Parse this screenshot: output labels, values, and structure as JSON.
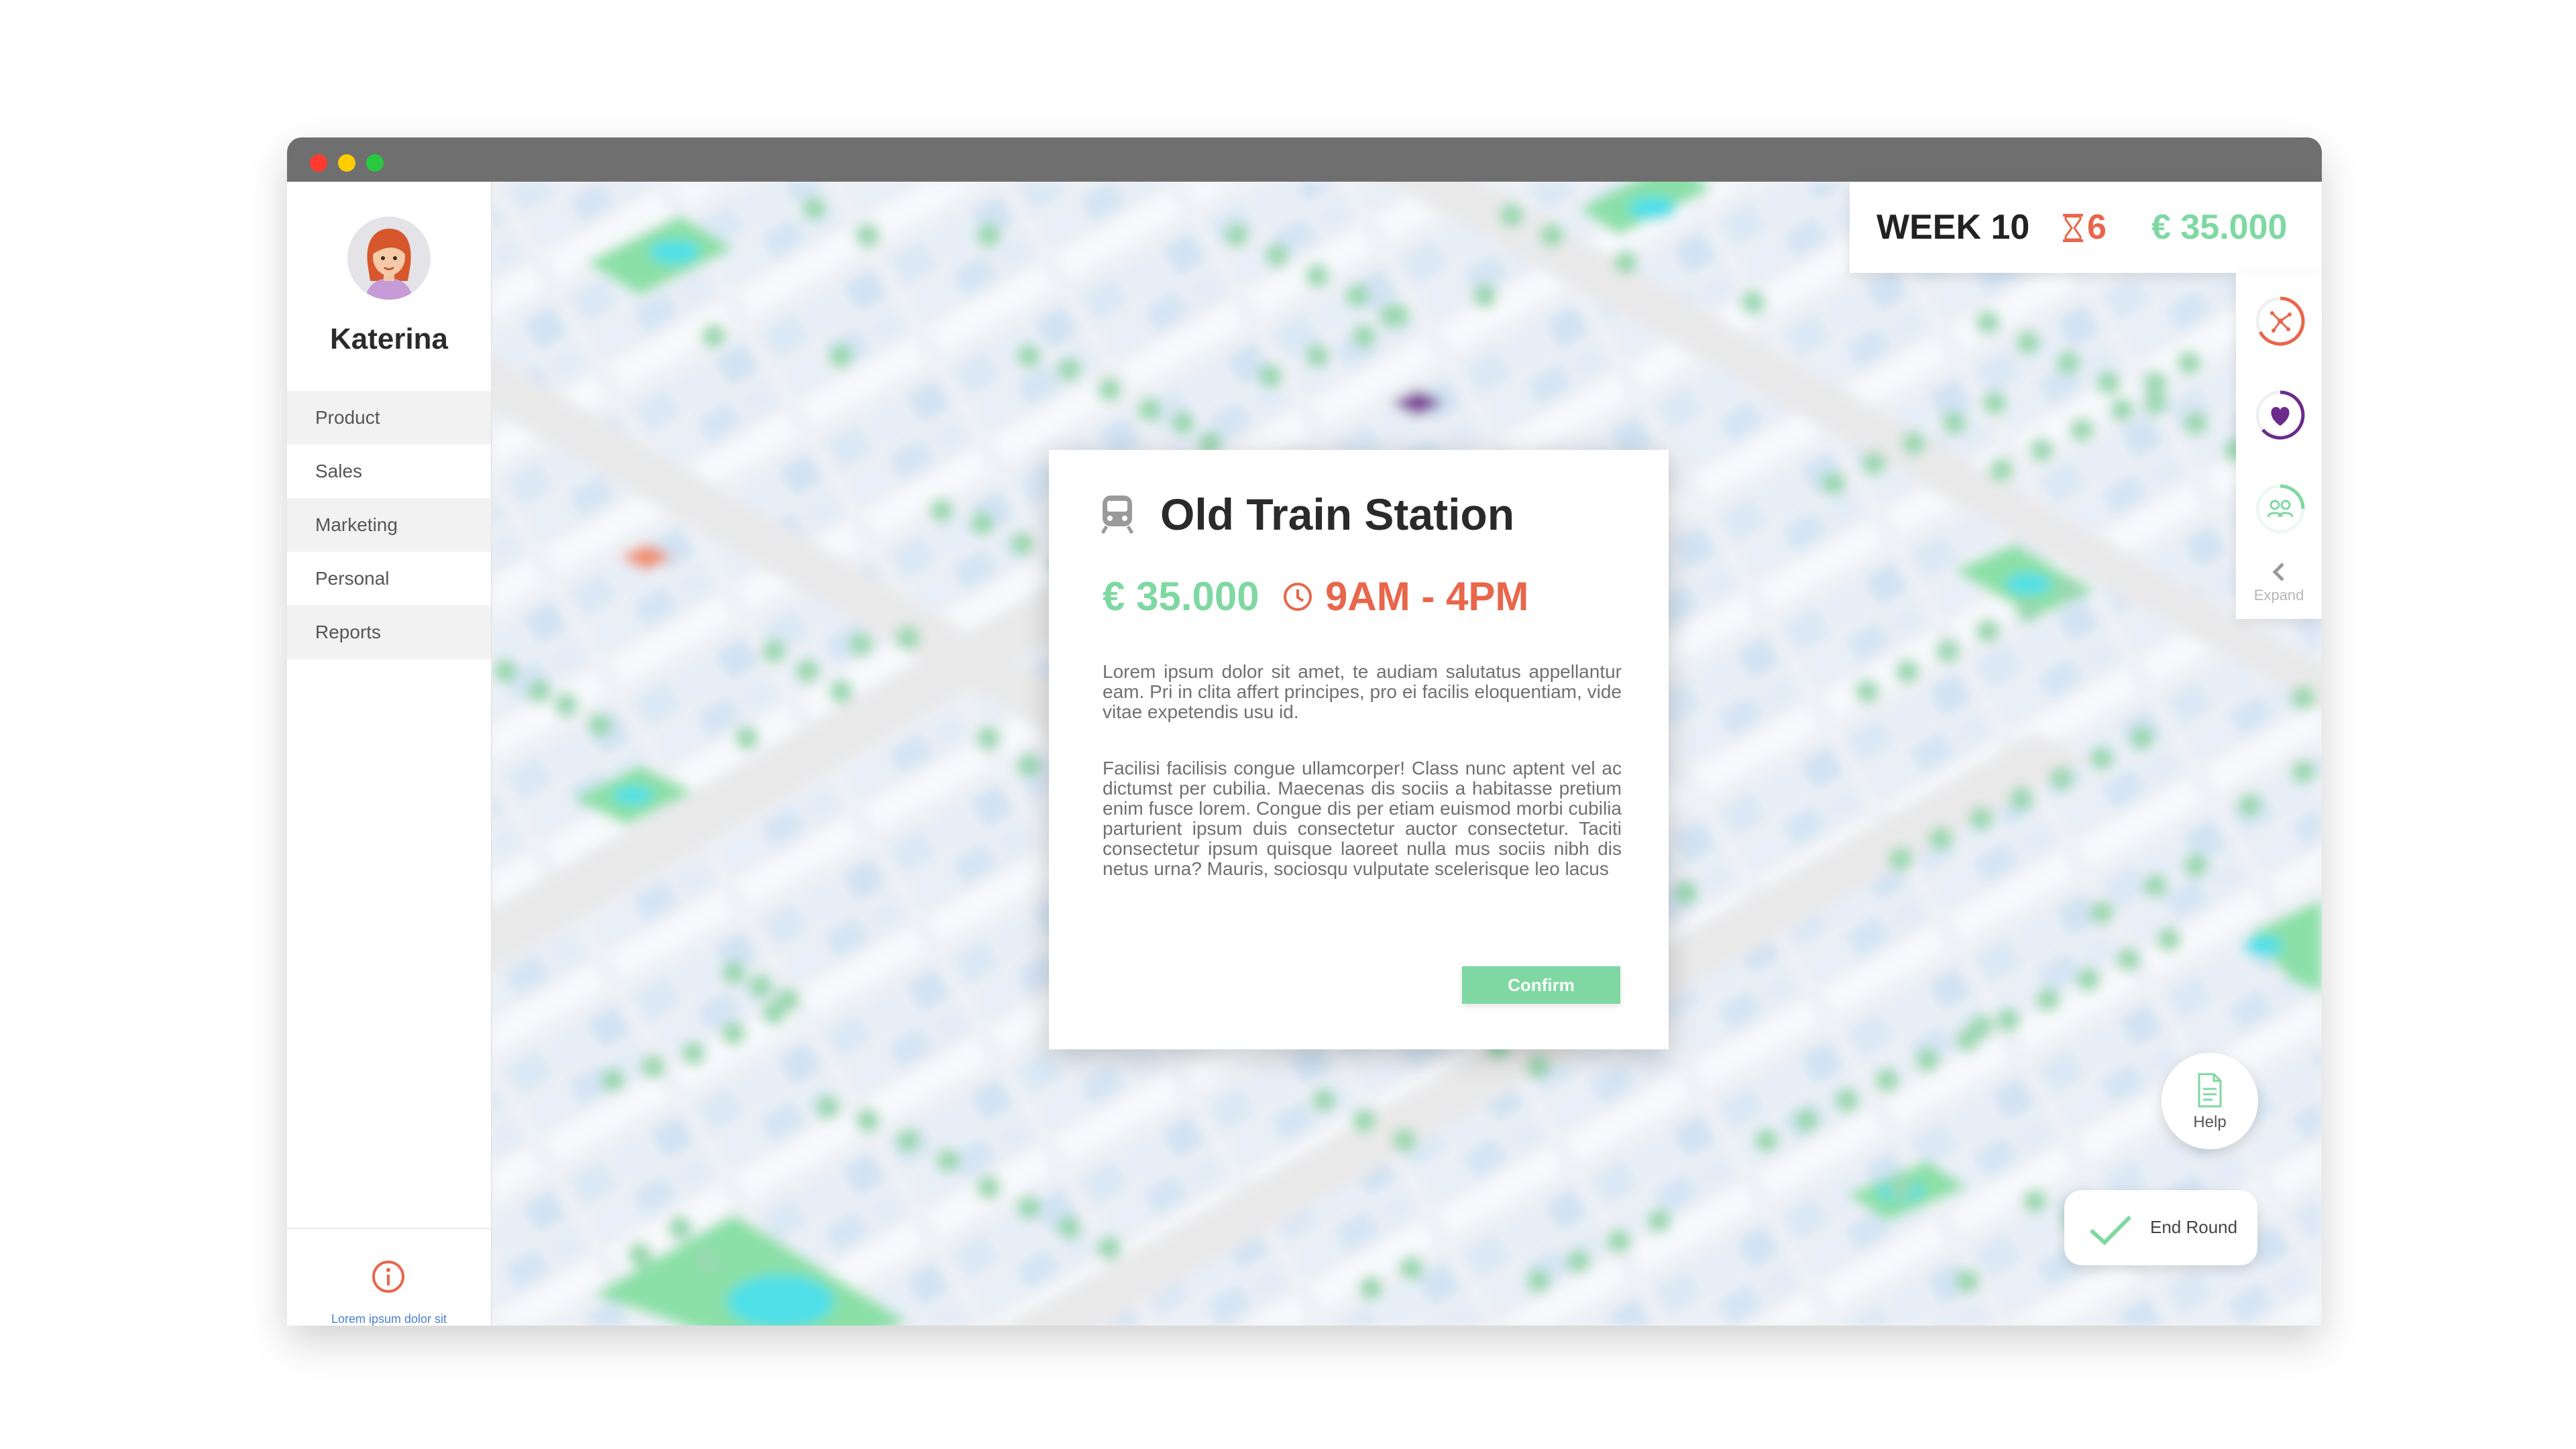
{
  "window": {
    "controls": [
      "close",
      "minimize",
      "maximize"
    ]
  },
  "sidebar": {
    "username": "Katerina",
    "items": [
      {
        "label": "Product"
      },
      {
        "label": "Sales"
      },
      {
        "label": "Marketing"
      },
      {
        "label": "Personal"
      },
      {
        "label": "Reports"
      }
    ],
    "info_text": "Lorem ipsum dolor sit amet, consectetur adipiscing elit, sed do eiusmod tempor incididunt ut labore et dolore magna aliqua."
  },
  "hud": {
    "week": "WEEK 10",
    "turns": "6",
    "money": "€ 35.000"
  },
  "stats_panel": {
    "icons": [
      "network-icon",
      "heart-icon",
      "people-icon"
    ],
    "expand_label": "Expand"
  },
  "modal": {
    "title": "Old Train Station",
    "price": "€ 35.000",
    "hours": "9AM - 4PM",
    "paragraph1": "Lorem ipsum dolor sit amet, te audiam salutatus appellantur eam. Pri in clita affert principes, pro ei facilis eloquentiam, vide vitae expetendis usu id.",
    "paragraph2": "Facilisi facilisis congue ullamcorper! Class nunc aptent vel ac dictumst per cubilia. Maecenas dis sociis a habitasse pretium enim fusce lorem. Congue dis per etiam euismod morbi cubilia parturient ipsum duis consectetur auctor consectetur. Taciti consectetur ipsum quisque laoreet nulla mus sociis nibh dis netus urna? Mauris, sociosqu vulputate scelerisque leo lacus",
    "confirm_label": "Confirm"
  },
  "help": {
    "label": "Help"
  },
  "end_round": {
    "label": "End Round"
  },
  "colors": {
    "accent_green": "#7fd8a2",
    "accent_orange": "#e8664a",
    "purple": "#6b2b8c",
    "link_blue": "#4a7fd0"
  }
}
